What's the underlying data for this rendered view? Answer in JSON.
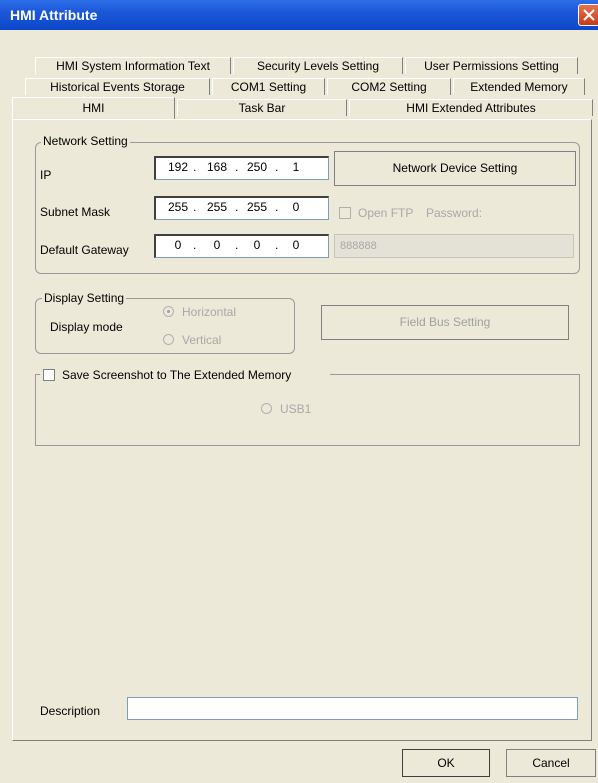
{
  "window": {
    "title": "HMI Attribute"
  },
  "tabs": {
    "row1": [
      "HMI System Information Text",
      "Security Levels Setting",
      "User Permissions Setting"
    ],
    "row2": [
      "Historical Events Storage",
      "COM1 Setting",
      "COM2 Setting",
      "Extended Memory"
    ],
    "row3": [
      "HMI",
      "Task Bar",
      "HMI Extended Attributes"
    ]
  },
  "network": {
    "group_label": "Network Setting",
    "ip_label": "IP",
    "ip": [
      "192",
      "168",
      "250",
      "1"
    ],
    "subnet_label": "Subnet Mask",
    "subnet": [
      "255",
      "255",
      "255",
      "0"
    ],
    "gateway_label": "Default Gateway",
    "gateway": [
      "0",
      "0",
      "0",
      "0"
    ],
    "device_button": "Network Device Setting",
    "open_ftp_label": "Open FTP",
    "password_label": "Password:",
    "password_value": "888888"
  },
  "display": {
    "group_label": "Display Setting",
    "mode_label": "Display mode",
    "horizontal": "Horizontal",
    "vertical": "Vertical",
    "fieldbus_button": "Field Bus Setting"
  },
  "screenshot": {
    "checkbox_label": "Save Screenshot to The Extended Memory",
    "usb_label": "USB1"
  },
  "description": {
    "label": "Description",
    "value": ""
  },
  "buttons": {
    "ok": "OK",
    "cancel": "Cancel"
  }
}
